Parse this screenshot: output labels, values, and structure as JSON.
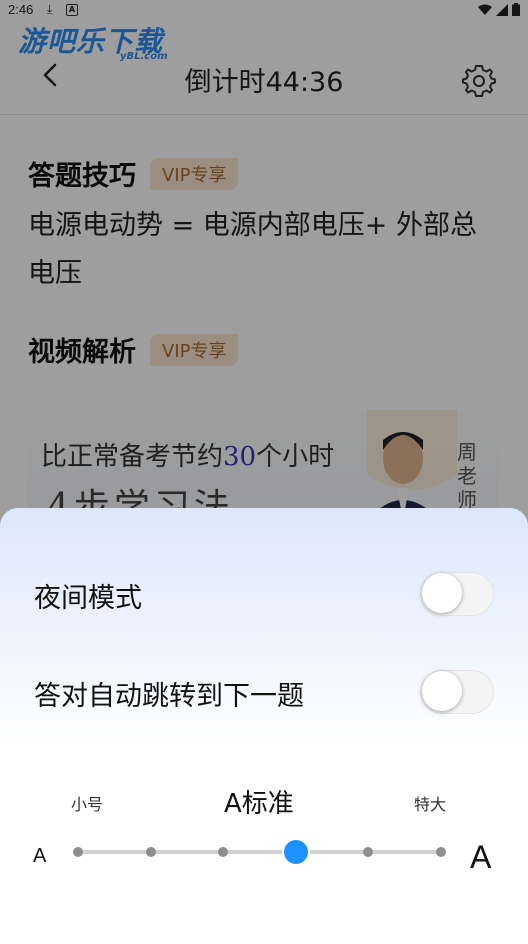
{
  "status_bar": {
    "time": "2:46"
  },
  "watermark": {
    "text": "游吧乐下载",
    "sub": "yBL.com"
  },
  "header": {
    "title": "倒计时44:36"
  },
  "tips": {
    "heading": "答题技巧",
    "badge": "VIP专享",
    "content": "电源电动势 = 电源内部电压+ 外部总电压"
  },
  "video_section": {
    "heading": "视频解析",
    "badge": "VIP专享",
    "thumbnail_line1_pre": "比正常备考节约",
    "thumbnail_line1_num": "30",
    "thumbnail_line1_post": "个小时",
    "thumbnail_line2": "4步学习法",
    "teacher": "周老师"
  },
  "settings_sheet": {
    "night_mode_label": "夜间模式",
    "night_mode_on": false,
    "auto_next_label": "答对自动跳转到下一题",
    "auto_next_on": false,
    "font_size": {
      "small_label": "小号",
      "current_label": "A标准",
      "large_label": "特大",
      "a_small": "A",
      "a_large": "A",
      "steps": 6,
      "selected_index": 3
    }
  },
  "colors": {
    "accent": "#1e90ff",
    "vip_text": "#a86b35",
    "vip_bg": "#fbe6cf"
  }
}
